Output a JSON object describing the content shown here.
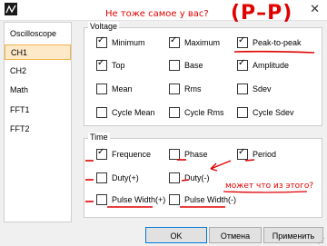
{
  "sidebar": {
    "items": [
      {
        "label": "Oscilloscope"
      },
      {
        "label": "CH1"
      },
      {
        "label": "CH2"
      },
      {
        "label": "Math"
      },
      {
        "label": "FFT1"
      },
      {
        "label": "FFT2"
      }
    ]
  },
  "voltage": {
    "title": "Voltage",
    "items": [
      {
        "label": "Minimum",
        "checked": true
      },
      {
        "label": "Maximum",
        "checked": true
      },
      {
        "label": "Peak-to-peak",
        "checked": true
      },
      {
        "label": "Top",
        "checked": true
      },
      {
        "label": "Base",
        "checked": false
      },
      {
        "label": "Amplitude",
        "checked": true
      },
      {
        "label": "Mean",
        "checked": false
      },
      {
        "label": "Rms",
        "checked": false
      },
      {
        "label": "Sdev",
        "checked": false
      },
      {
        "label": "Cycle Mean",
        "checked": false
      },
      {
        "label": "Cycle Rms",
        "checked": false
      },
      {
        "label": "Cycle Sdev",
        "checked": false
      }
    ]
  },
  "time": {
    "title": "Time",
    "items": [
      {
        "label": "Frequence",
        "checked": true
      },
      {
        "label": "Phase",
        "checked": false
      },
      {
        "label": "Period",
        "checked": true
      },
      {
        "label": "Duty(+)",
        "checked": false
      },
      {
        "label": "Duty(-)",
        "checked": false
      },
      {
        "label": "Pulse Width(+)",
        "checked": false
      },
      {
        "label": "Pulse Width(-)",
        "checked": false
      }
    ]
  },
  "annotations": {
    "question_top": "Не тоже самое у вас?",
    "p_minus_p": "(P–P)",
    "question_bottom": "может что из этого?"
  },
  "buttons": {
    "ok": "OK",
    "cancel": "Отмена",
    "apply": "Применить"
  },
  "colors": {
    "annotation": "#e00000",
    "selected_bg": "#fde8c7",
    "selected_border": "#f0b24b",
    "default_button_border": "#0078d7"
  }
}
